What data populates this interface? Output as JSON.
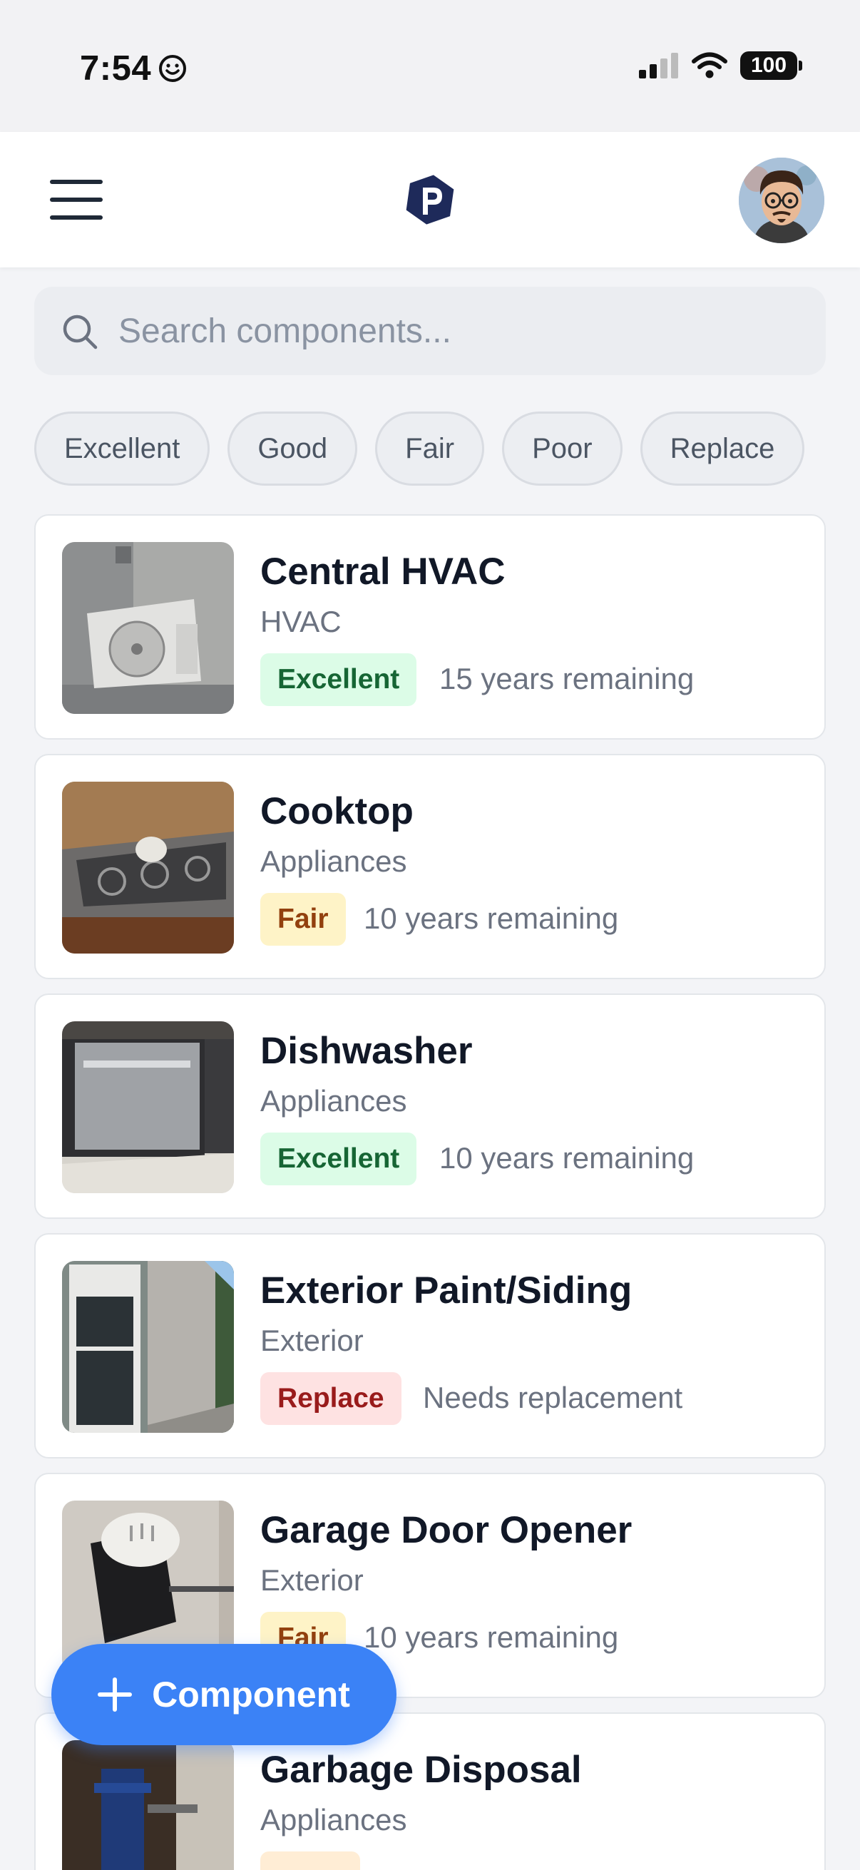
{
  "status_bar": {
    "time": "7:54",
    "battery": "100"
  },
  "header": {
    "menu_icon": "hamburger-menu-icon",
    "logo_icon": "p-hexagon-logo",
    "avatar_icon": "user-avatar"
  },
  "search": {
    "placeholder": "Search components..."
  },
  "filters": [
    "Excellent",
    "Good",
    "Fair",
    "Poor",
    "Replace"
  ],
  "components": [
    {
      "name": "Central HVAC",
      "category": "HVAC",
      "condition": "Excellent",
      "remaining": "15 years remaining"
    },
    {
      "name": "Cooktop",
      "category": "Appliances",
      "condition": "Fair",
      "remaining": "10 years remaining"
    },
    {
      "name": "Dishwasher",
      "category": "Appliances",
      "condition": "Excellent",
      "remaining": "10 years remaining"
    },
    {
      "name": "Exterior Paint/Siding",
      "category": "Exterior",
      "condition": "Replace",
      "remaining": "Needs replacement"
    },
    {
      "name": "Garage Door Opener",
      "category": "Exterior",
      "condition": "Fair",
      "remaining": "10 years remaining"
    },
    {
      "name": "Garbage Disposal",
      "category": "Appliances",
      "condition": "",
      "remaining": ""
    }
  ],
  "fab": {
    "label": "Component"
  },
  "colors": {
    "accent": "#3b82f6",
    "excellent_bg": "#dcfce7",
    "excellent_text": "#166534",
    "fair_bg": "#fef3c7",
    "fair_text": "#92400e",
    "replace_bg": "#fee2e2",
    "replace_text": "#991b1b"
  }
}
